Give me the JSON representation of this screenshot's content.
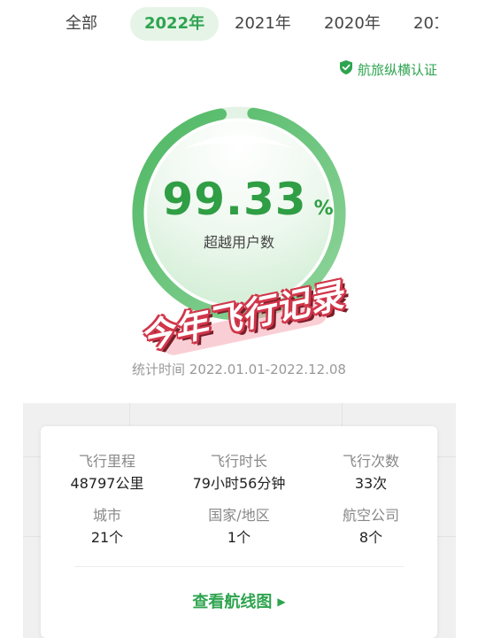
{
  "tabs": {
    "all": "全部",
    "y2022": "2022年",
    "y2021": "2021年",
    "y2020": "2020年",
    "y2019_partial": "201"
  },
  "certification": {
    "label": "航旅纵横认证",
    "icon": "shield-check-icon",
    "color": "#2ea44f"
  },
  "percentile": {
    "value": "99.33",
    "unit": "%",
    "label": "超越用户数",
    "fill_fraction": 0.9933,
    "accent": "#3cb25a"
  },
  "stamp": {
    "text": "今年飞行记录"
  },
  "date_range": "统计时间 2022.01.01-2022.12.08",
  "stats": {
    "distance": {
      "label": "飞行里程",
      "value": "48797公里"
    },
    "duration": {
      "label": "飞行时长",
      "value": "79小时56分钟"
    },
    "flights": {
      "label": "飞行次数",
      "value": "33次"
    },
    "cities": {
      "label": "城市",
      "value": "21个"
    },
    "countries": {
      "label": "国家/地区",
      "value": "1个"
    },
    "airlines": {
      "label": "航空公司",
      "value": "8个"
    }
  },
  "route_link": {
    "label": "查看航线图",
    "icon": "caret-right-icon"
  }
}
